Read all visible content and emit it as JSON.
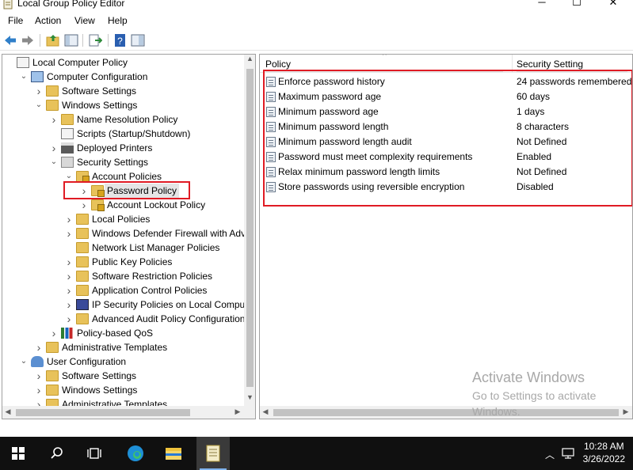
{
  "window": {
    "title": "Local Group Policy Editor"
  },
  "menu": [
    "File",
    "Action",
    "View",
    "Help"
  ],
  "tree": [
    {
      "label": "Local Computer Policy",
      "indent": 0,
      "expander": "",
      "icon": "computer-policy-icon"
    },
    {
      "label": "Computer Configuration",
      "indent": 1,
      "expander": "v",
      "icon": "computer-icon"
    },
    {
      "label": "Software Settings",
      "indent": 2,
      "expander": ">",
      "icon": "folder-icon"
    },
    {
      "label": "Windows Settings",
      "indent": 2,
      "expander": "v",
      "icon": "folder-icon"
    },
    {
      "label": "Name Resolution Policy",
      "indent": 3,
      "expander": ">",
      "icon": "folder-icon"
    },
    {
      "label": "Scripts (Startup/Shutdown)",
      "indent": 3,
      "expander": "",
      "icon": "script-icon"
    },
    {
      "label": "Deployed Printers",
      "indent": 3,
      "expander": ">",
      "icon": "printer-icon"
    },
    {
      "label": "Security Settings",
      "indent": 3,
      "expander": "v",
      "icon": "security-icon"
    },
    {
      "label": "Account Policies",
      "indent": 4,
      "expander": "v",
      "icon": "folder-lock-icon"
    },
    {
      "label": "Password Policy",
      "indent": 5,
      "expander": ">",
      "icon": "folder-lock-icon",
      "selected": true
    },
    {
      "label": "Account Lockout Policy",
      "indent": 5,
      "expander": ">",
      "icon": "folder-lock-icon"
    },
    {
      "label": "Local Policies",
      "indent": 4,
      "expander": ">",
      "icon": "folder-icon"
    },
    {
      "label": "Windows Defender Firewall with Advar",
      "indent": 4,
      "expander": ">",
      "icon": "folder-icon"
    },
    {
      "label": "Network List Manager Policies",
      "indent": 4,
      "expander": "",
      "icon": "folder-icon"
    },
    {
      "label": "Public Key Policies",
      "indent": 4,
      "expander": ">",
      "icon": "folder-icon"
    },
    {
      "label": "Software Restriction Policies",
      "indent": 4,
      "expander": ">",
      "icon": "folder-icon"
    },
    {
      "label": "Application Control Policies",
      "indent": 4,
      "expander": ">",
      "icon": "folder-icon"
    },
    {
      "label": "IP Security Policies on Local Computer",
      "indent": 4,
      "expander": ">",
      "icon": "ip-security-icon"
    },
    {
      "label": "Advanced Audit Policy Configuration",
      "indent": 4,
      "expander": ">",
      "icon": "folder-icon"
    },
    {
      "label": "Policy-based QoS",
      "indent": 3,
      "expander": ">",
      "icon": "chart-icon"
    },
    {
      "label": "Administrative Templates",
      "indent": 2,
      "expander": ">",
      "icon": "folder-icon"
    },
    {
      "label": "User Configuration",
      "indent": 1,
      "expander": "v",
      "icon": "user-icon"
    },
    {
      "label": "Software Settings",
      "indent": 2,
      "expander": ">",
      "icon": "folder-icon"
    },
    {
      "label": "Windows Settings",
      "indent": 2,
      "expander": ">",
      "icon": "folder-icon"
    },
    {
      "label": "Administrative Templates",
      "indent": 2,
      "expander": ">",
      "icon": "folder-icon"
    }
  ],
  "list": {
    "columns": {
      "policy": "Policy",
      "setting": "Security Setting"
    },
    "rows": [
      {
        "policy": "Enforce password history",
        "setting": "24 passwords remembered"
      },
      {
        "policy": "Maximum password age",
        "setting": "60 days"
      },
      {
        "policy": "Minimum password age",
        "setting": "1 days"
      },
      {
        "policy": "Minimum password length",
        "setting": "8 characters"
      },
      {
        "policy": "Minimum password length audit",
        "setting": "Not Defined"
      },
      {
        "policy": "Password must meet complexity requirements",
        "setting": "Enabled"
      },
      {
        "policy": "Relax minimum password length limits",
        "setting": "Not Defined"
      },
      {
        "policy": "Store passwords using reversible encryption",
        "setting": "Disabled"
      }
    ]
  },
  "watermark": {
    "line1": "Activate Windows",
    "line2": "Go to Settings to activate",
    "line3": "Windows."
  },
  "taskbar": {
    "time": "10:28 AM",
    "date": "3/26/2022"
  },
  "colors": {
    "highlight": "#e01b24",
    "taskbar": "#101010",
    "folder": "#e8c25a"
  }
}
